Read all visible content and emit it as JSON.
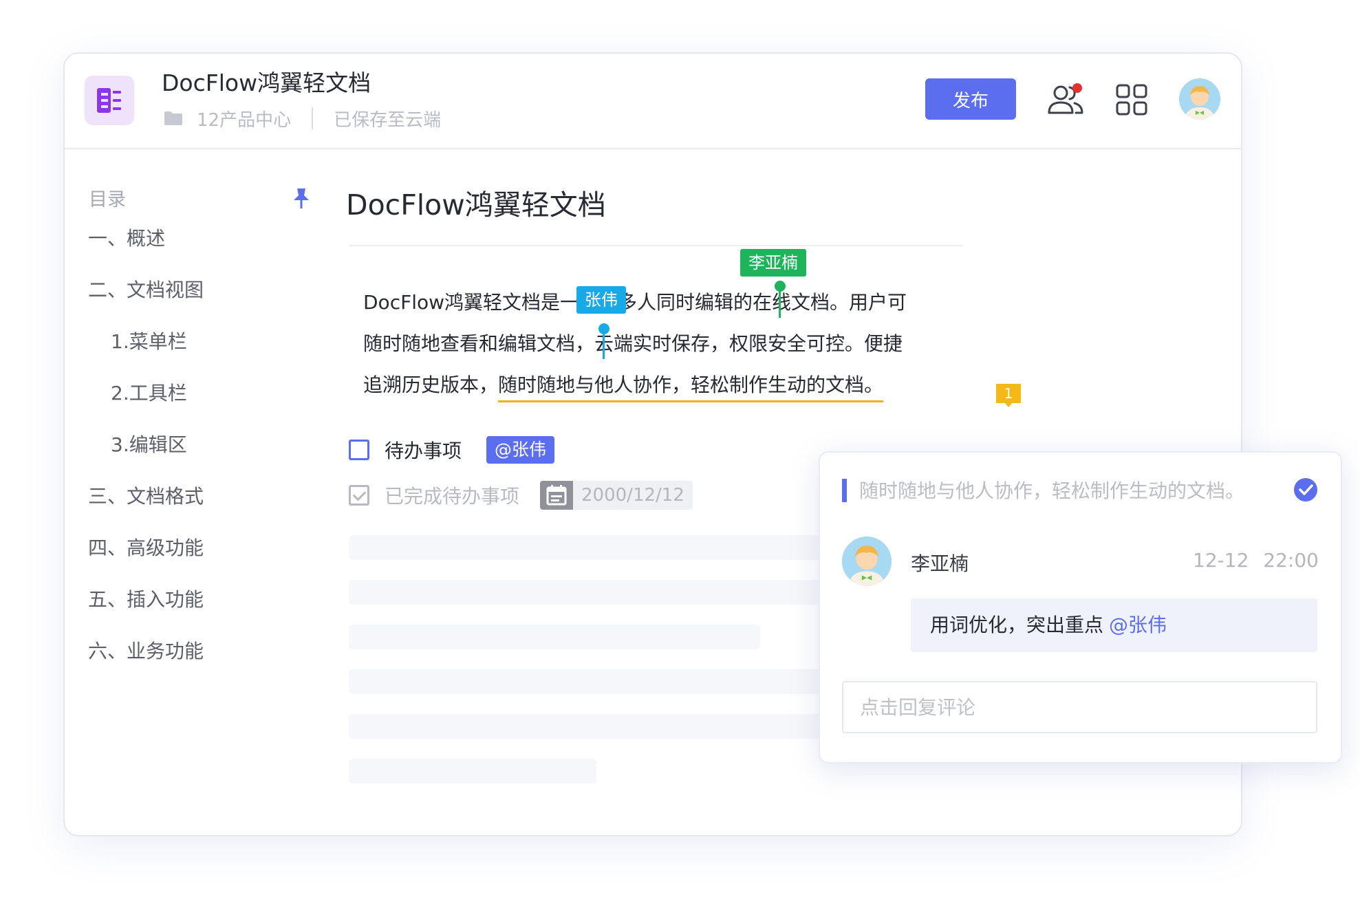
{
  "header": {
    "app_icon": "doc-app-icon",
    "title": "DocFlow鸿翼轻文档",
    "breadcrumb_icon": "folder-icon",
    "breadcrumb": "12产品中心",
    "save_status": "已保存至云端",
    "publish_label": "发布",
    "collaborators_icon": "users-icon",
    "apps_icon": "apps-grid-icon",
    "notification_color": "#e5322d"
  },
  "toc": {
    "title": "目录",
    "pin_icon": "pin-icon",
    "items": [
      {
        "label": "一、概述"
      },
      {
        "label": "二、文档视图"
      },
      {
        "label": "1.菜单栏"
      },
      {
        "label": "2.工具栏"
      },
      {
        "label": "3.编辑区"
      },
      {
        "label": "三、文档格式"
      },
      {
        "label": "四、高级功能"
      },
      {
        "label": "五、插入功能"
      },
      {
        "label": "六、业务功能"
      }
    ]
  },
  "document": {
    "heading": "DocFlow鸿翼轻文档",
    "line1": "DocFlow鸿翼轻文档是一款可多人同时编辑的在线文档。用户可",
    "line2": "随时随地查看和编辑文档，云端实时保存，权限安全可控。便捷",
    "line3_plain": "追溯历史版本，",
    "line3_highlight": "随时随地与他人协作，轻松制作生动的文档。",
    "comment_count": "1",
    "comment_marker_color": "#f5b917",
    "underline_color": "#f2b21b"
  },
  "cursors": [
    {
      "name": "李亚楠",
      "color": "#1db45c"
    },
    {
      "name": "张伟",
      "color": "#17a9e8"
    }
  ],
  "todos": [
    {
      "label": "待办事项",
      "done": false,
      "mention": "@张伟"
    },
    {
      "label": "已完成待办事项",
      "done": true,
      "date": "2000/12/12",
      "date_icon": "calendar-icon"
    }
  ],
  "comment": {
    "quote": "随时随地与他人协作，轻松制作生动的文档。",
    "resolve_icon": "check-circle-icon",
    "author": "李亚楠",
    "time": "12-12 22:00",
    "body": "用词优化，突出重点",
    "mention": "@张伟",
    "reply_placeholder": "点击回复评论"
  },
  "colors": {
    "accent": "#5b6ef0"
  }
}
